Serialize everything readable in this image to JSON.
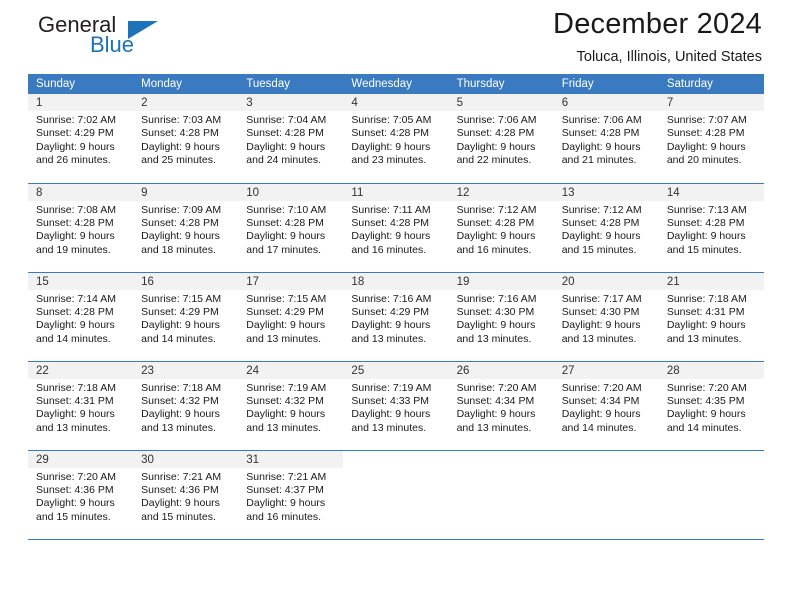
{
  "brand": {
    "name_top": "General",
    "name_bottom": "Blue",
    "accent_color": "#1d72b8"
  },
  "header": {
    "month_title": "December 2024",
    "location": "Toluca, Illinois, United States"
  },
  "theme": {
    "header_bg": "#3a7ac0",
    "daynum_bg": "#f2f2f2",
    "text": "#1a1a1a"
  },
  "calendar": {
    "weekday_headers": [
      "Sunday",
      "Monday",
      "Tuesday",
      "Wednesday",
      "Thursday",
      "Friday",
      "Saturday"
    ],
    "weeks": [
      [
        {
          "day": "1",
          "sunrise": "Sunrise: 7:02 AM",
          "sunset": "Sunset: 4:29 PM",
          "daylight_line1": "Daylight: 9 hours",
          "daylight_line2": "and 26 minutes."
        },
        {
          "day": "2",
          "sunrise": "Sunrise: 7:03 AM",
          "sunset": "Sunset: 4:28 PM",
          "daylight_line1": "Daylight: 9 hours",
          "daylight_line2": "and 25 minutes."
        },
        {
          "day": "3",
          "sunrise": "Sunrise: 7:04 AM",
          "sunset": "Sunset: 4:28 PM",
          "daylight_line1": "Daylight: 9 hours",
          "daylight_line2": "and 24 minutes."
        },
        {
          "day": "4",
          "sunrise": "Sunrise: 7:05 AM",
          "sunset": "Sunset: 4:28 PM",
          "daylight_line1": "Daylight: 9 hours",
          "daylight_line2": "and 23 minutes."
        },
        {
          "day": "5",
          "sunrise": "Sunrise: 7:06 AM",
          "sunset": "Sunset: 4:28 PM",
          "daylight_line1": "Daylight: 9 hours",
          "daylight_line2": "and 22 minutes."
        },
        {
          "day": "6",
          "sunrise": "Sunrise: 7:06 AM",
          "sunset": "Sunset: 4:28 PM",
          "daylight_line1": "Daylight: 9 hours",
          "daylight_line2": "and 21 minutes."
        },
        {
          "day": "7",
          "sunrise": "Sunrise: 7:07 AM",
          "sunset": "Sunset: 4:28 PM",
          "daylight_line1": "Daylight: 9 hours",
          "daylight_line2": "and 20 minutes."
        }
      ],
      [
        {
          "day": "8",
          "sunrise": "Sunrise: 7:08 AM",
          "sunset": "Sunset: 4:28 PM",
          "daylight_line1": "Daylight: 9 hours",
          "daylight_line2": "and 19 minutes."
        },
        {
          "day": "9",
          "sunrise": "Sunrise: 7:09 AM",
          "sunset": "Sunset: 4:28 PM",
          "daylight_line1": "Daylight: 9 hours",
          "daylight_line2": "and 18 minutes."
        },
        {
          "day": "10",
          "sunrise": "Sunrise: 7:10 AM",
          "sunset": "Sunset: 4:28 PM",
          "daylight_line1": "Daylight: 9 hours",
          "daylight_line2": "and 17 minutes."
        },
        {
          "day": "11",
          "sunrise": "Sunrise: 7:11 AM",
          "sunset": "Sunset: 4:28 PM",
          "daylight_line1": "Daylight: 9 hours",
          "daylight_line2": "and 16 minutes."
        },
        {
          "day": "12",
          "sunrise": "Sunrise: 7:12 AM",
          "sunset": "Sunset: 4:28 PM",
          "daylight_line1": "Daylight: 9 hours",
          "daylight_line2": "and 16 minutes."
        },
        {
          "day": "13",
          "sunrise": "Sunrise: 7:12 AM",
          "sunset": "Sunset: 4:28 PM",
          "daylight_line1": "Daylight: 9 hours",
          "daylight_line2": "and 15 minutes."
        },
        {
          "day": "14",
          "sunrise": "Sunrise: 7:13 AM",
          "sunset": "Sunset: 4:28 PM",
          "daylight_line1": "Daylight: 9 hours",
          "daylight_line2": "and 15 minutes."
        }
      ],
      [
        {
          "day": "15",
          "sunrise": "Sunrise: 7:14 AM",
          "sunset": "Sunset: 4:28 PM",
          "daylight_line1": "Daylight: 9 hours",
          "daylight_line2": "and 14 minutes."
        },
        {
          "day": "16",
          "sunrise": "Sunrise: 7:15 AM",
          "sunset": "Sunset: 4:29 PM",
          "daylight_line1": "Daylight: 9 hours",
          "daylight_line2": "and 14 minutes."
        },
        {
          "day": "17",
          "sunrise": "Sunrise: 7:15 AM",
          "sunset": "Sunset: 4:29 PM",
          "daylight_line1": "Daylight: 9 hours",
          "daylight_line2": "and 13 minutes."
        },
        {
          "day": "18",
          "sunrise": "Sunrise: 7:16 AM",
          "sunset": "Sunset: 4:29 PM",
          "daylight_line1": "Daylight: 9 hours",
          "daylight_line2": "and 13 minutes."
        },
        {
          "day": "19",
          "sunrise": "Sunrise: 7:16 AM",
          "sunset": "Sunset: 4:30 PM",
          "daylight_line1": "Daylight: 9 hours",
          "daylight_line2": "and 13 minutes."
        },
        {
          "day": "20",
          "sunrise": "Sunrise: 7:17 AM",
          "sunset": "Sunset: 4:30 PM",
          "daylight_line1": "Daylight: 9 hours",
          "daylight_line2": "and 13 minutes."
        },
        {
          "day": "21",
          "sunrise": "Sunrise: 7:18 AM",
          "sunset": "Sunset: 4:31 PM",
          "daylight_line1": "Daylight: 9 hours",
          "daylight_line2": "and 13 minutes."
        }
      ],
      [
        {
          "day": "22",
          "sunrise": "Sunrise: 7:18 AM",
          "sunset": "Sunset: 4:31 PM",
          "daylight_line1": "Daylight: 9 hours",
          "daylight_line2": "and 13 minutes."
        },
        {
          "day": "23",
          "sunrise": "Sunrise: 7:18 AM",
          "sunset": "Sunset: 4:32 PM",
          "daylight_line1": "Daylight: 9 hours",
          "daylight_line2": "and 13 minutes."
        },
        {
          "day": "24",
          "sunrise": "Sunrise: 7:19 AM",
          "sunset": "Sunset: 4:32 PM",
          "daylight_line1": "Daylight: 9 hours",
          "daylight_line2": "and 13 minutes."
        },
        {
          "day": "25",
          "sunrise": "Sunrise: 7:19 AM",
          "sunset": "Sunset: 4:33 PM",
          "daylight_line1": "Daylight: 9 hours",
          "daylight_line2": "and 13 minutes."
        },
        {
          "day": "26",
          "sunrise": "Sunrise: 7:20 AM",
          "sunset": "Sunset: 4:34 PM",
          "daylight_line1": "Daylight: 9 hours",
          "daylight_line2": "and 13 minutes."
        },
        {
          "day": "27",
          "sunrise": "Sunrise: 7:20 AM",
          "sunset": "Sunset: 4:34 PM",
          "daylight_line1": "Daylight: 9 hours",
          "daylight_line2": "and 14 minutes."
        },
        {
          "day": "28",
          "sunrise": "Sunrise: 7:20 AM",
          "sunset": "Sunset: 4:35 PM",
          "daylight_line1": "Daylight: 9 hours",
          "daylight_line2": "and 14 minutes."
        }
      ],
      [
        {
          "day": "29",
          "sunrise": "Sunrise: 7:20 AM",
          "sunset": "Sunset: 4:36 PM",
          "daylight_line1": "Daylight: 9 hours",
          "daylight_line2": "and 15 minutes."
        },
        {
          "day": "30",
          "sunrise": "Sunrise: 7:21 AM",
          "sunset": "Sunset: 4:36 PM",
          "daylight_line1": "Daylight: 9 hours",
          "daylight_line2": "and 15 minutes."
        },
        {
          "day": "31",
          "sunrise": "Sunrise: 7:21 AM",
          "sunset": "Sunset: 4:37 PM",
          "daylight_line1": "Daylight: 9 hours",
          "daylight_line2": "and 16 minutes."
        },
        {
          "day": "",
          "sunrise": "",
          "sunset": "",
          "daylight_line1": "",
          "daylight_line2": ""
        },
        {
          "day": "",
          "sunrise": "",
          "sunset": "",
          "daylight_line1": "",
          "daylight_line2": ""
        },
        {
          "day": "",
          "sunrise": "",
          "sunset": "",
          "daylight_line1": "",
          "daylight_line2": ""
        },
        {
          "day": "",
          "sunrise": "",
          "sunset": "",
          "daylight_line1": "",
          "daylight_line2": ""
        }
      ]
    ]
  }
}
